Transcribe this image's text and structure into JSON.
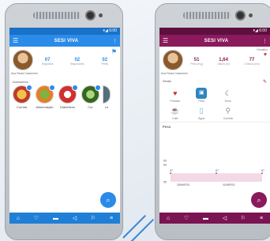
{
  "left_phone": {
    "status": "▾◢ 6:00",
    "brand": "SESI VIVA",
    "profile": {
      "name": "Ana Paula Cassemiro",
      "stats": [
        {
          "value": "07",
          "label": "Seguidos"
        },
        {
          "value": "02",
          "label": "Seguidores"
        },
        {
          "value": "02",
          "label": "Perfis"
        }
      ]
    },
    "section_title": "Acessórios",
    "categories": [
      {
        "label": "Corrida"
      },
      {
        "label": "Alimentação"
      },
      {
        "label": "Diabéticos"
      },
      {
        "label": "Cor"
      },
      {
        "label": "Le"
      }
    ],
    "colors": {
      "accent": "#2b8be8",
      "bar": "#1f7fd6"
    }
  },
  "right_phone": {
    "status": "▾◢ 6:00",
    "brand": "SESI VIVA",
    "top_right_label": "Desafios",
    "profile": {
      "name": "Ana Paula Cassemiro",
      "stats": [
        {
          "value": "51",
          "label": "Peso (Kg)"
        },
        {
          "value": "1,64",
          "label": "Altura (m)"
        },
        {
          "value": "77",
          "label": "Cintura (cm)"
        }
      ]
    },
    "section_title": "Sinais",
    "items": [
      {
        "label": "Pressão",
        "icon": "heart-rate-icon"
      },
      {
        "label": "Peso",
        "icon": "scale-icon"
      },
      {
        "label": "Sono",
        "icon": "sleep-icon"
      },
      {
        "label": "",
        "icon": "blank"
      },
      {
        "label": "Café",
        "icon": "coffee-icon"
      },
      {
        "label": "Água",
        "icon": "water-icon"
      },
      {
        "label": "Comida",
        "icon": "food-icon"
      }
    ],
    "chart_title": "Peso",
    "chart_data": {
      "type": "area",
      "title": "Peso",
      "x": [
        "30/MAR/15",
        "01/ABR/15",
        ""
      ],
      "values": [
        57,
        57,
        57
      ],
      "ylim": [
        55,
        60
      ],
      "yticks": [
        "60",
        "59",
        "55"
      ]
    },
    "colors": {
      "accent": "#8a1a5c",
      "bar": "#7a1452"
    }
  }
}
